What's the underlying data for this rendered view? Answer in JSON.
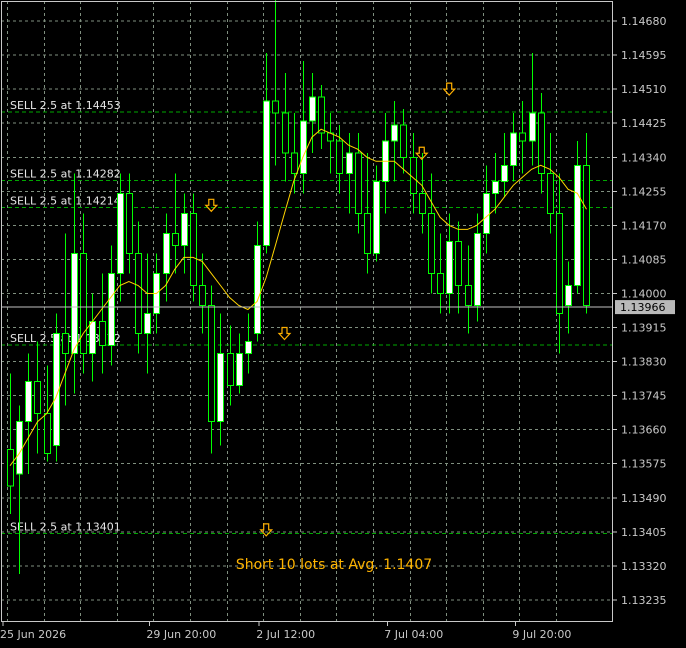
{
  "colors": {
    "background": "#000000",
    "grid": "#7f8f7f",
    "axis": "#c8c8c8",
    "bull": "#ffffff",
    "bear": "#000000",
    "wick": "#00ff00",
    "ma": "#ffd400",
    "trade_line": "#00a800",
    "trade_label": "#e6e6e6",
    "arrow": "#ffb000",
    "price_box_bg": "#b9b9b9",
    "summary": "#ffb400"
  },
  "chart_data": {
    "type": "candlestick",
    "symbol_timeframe": "",
    "price_axis_labels": [
      "1.14680",
      "1.14595",
      "1.14510",
      "1.14425",
      "1.14340",
      "1.14255",
      "1.14170",
      "1.14085",
      "1.14000",
      "1.13915",
      "1.13830",
      "1.13745",
      "1.13660",
      "1.13575",
      "1.13490",
      "1.13405",
      "1.13320",
      "1.13235"
    ],
    "time_axis_labels": [
      "25 Jun 2026",
      "29 Jun 20:00",
      "2 Jul 12:00",
      "7 Jul 04:00",
      "9 Jul 20:00"
    ],
    "ylim": [
      1.1318,
      1.1473
    ],
    "current_price": "1.13966",
    "trade_lines": [
      {
        "label": "SELL 2.5 at 1.14453",
        "price": 1.14453
      },
      {
        "label": "SELL 2.5 at 1.14282",
        "price": 1.14282
      },
      {
        "label": "SELL 2.5 at 1.14214",
        "price": 1.14214
      },
      {
        "label": "SELL 2.5 at 1.13872",
        "price": 1.13872
      },
      {
        "label": "SELL 2.5 at 1.13401",
        "price": 1.13401
      }
    ],
    "sell_arrows": [
      {
        "index": 48,
        "price": 1.1451
      },
      {
        "index": 45,
        "price": 1.1435
      },
      {
        "index": 22,
        "price": 1.1422
      },
      {
        "index": 30,
        "price": 1.139
      },
      {
        "index": 28,
        "price": 1.1341
      }
    ],
    "summary_text": "Short 10 lots at Avg. 1.1407",
    "candles": [
      {
        "o": 1.1361,
        "h": 1.138,
        "l": 1.1345,
        "c": 1.1352
      },
      {
        "o": 1.1355,
        "h": 1.1372,
        "l": 1.133,
        "c": 1.1368
      },
      {
        "o": 1.1368,
        "h": 1.1385,
        "l": 1.1355,
        "c": 1.1378
      },
      {
        "o": 1.1378,
        "h": 1.1388,
        "l": 1.136,
        "c": 1.137
      },
      {
        "o": 1.137,
        "h": 1.1382,
        "l": 1.1358,
        "c": 1.136
      },
      {
        "o": 1.1362,
        "h": 1.1395,
        "l": 1.1358,
        "c": 1.139
      },
      {
        "o": 1.139,
        "h": 1.1415,
        "l": 1.1372,
        "c": 1.1385
      },
      {
        "o": 1.1385,
        "h": 1.143,
        "l": 1.1375,
        "c": 1.141
      },
      {
        "o": 1.141,
        "h": 1.142,
        "l": 1.138,
        "c": 1.1385
      },
      {
        "o": 1.1385,
        "h": 1.14,
        "l": 1.1378,
        "c": 1.1393
      },
      {
        "o": 1.1393,
        "h": 1.1405,
        "l": 1.138,
        "c": 1.1387
      },
      {
        "o": 1.1387,
        "h": 1.1412,
        "l": 1.1382,
        "c": 1.1405
      },
      {
        "o": 1.1405,
        "h": 1.143,
        "l": 1.1398,
        "c": 1.1425
      },
      {
        "o": 1.1425,
        "h": 1.143,
        "l": 1.1405,
        "c": 1.141
      },
      {
        "o": 1.141,
        "h": 1.1418,
        "l": 1.1385,
        "c": 1.139
      },
      {
        "o": 1.139,
        "h": 1.141,
        "l": 1.138,
        "c": 1.1395
      },
      {
        "o": 1.1395,
        "h": 1.141,
        "l": 1.139,
        "c": 1.1405
      },
      {
        "o": 1.1405,
        "h": 1.142,
        "l": 1.1398,
        "c": 1.1415
      },
      {
        "o": 1.1415,
        "h": 1.143,
        "l": 1.1405,
        "c": 1.1412
      },
      {
        "o": 1.1412,
        "h": 1.1425,
        "l": 1.1405,
        "c": 1.142
      },
      {
        "o": 1.142,
        "h": 1.1425,
        "l": 1.1398,
        "c": 1.1402
      },
      {
        "o": 1.1402,
        "h": 1.141,
        "l": 1.139,
        "c": 1.1397
      },
      {
        "o": 1.1397,
        "h": 1.1402,
        "l": 1.136,
        "c": 1.1368
      },
      {
        "o": 1.1368,
        "h": 1.1395,
        "l": 1.1362,
        "c": 1.1385
      },
      {
        "o": 1.1385,
        "h": 1.1392,
        "l": 1.1372,
        "c": 1.1377
      },
      {
        "o": 1.1377,
        "h": 1.139,
        "l": 1.1375,
        "c": 1.1385
      },
      {
        "o": 1.1385,
        "h": 1.1395,
        "l": 1.138,
        "c": 1.1388
      },
      {
        "o": 1.139,
        "h": 1.1418,
        "l": 1.1388,
        "c": 1.1412
      },
      {
        "o": 1.1412,
        "h": 1.146,
        "l": 1.141,
        "c": 1.1448
      },
      {
        "o": 1.1448,
        "h": 1.1475,
        "l": 1.1432,
        "c": 1.1445
      },
      {
        "o": 1.1445,
        "h": 1.1455,
        "l": 1.1428,
        "c": 1.1435
      },
      {
        "o": 1.1435,
        "h": 1.1445,
        "l": 1.1425,
        "c": 1.143
      },
      {
        "o": 1.143,
        "h": 1.1458,
        "l": 1.1425,
        "c": 1.1443
      },
      {
        "o": 1.1443,
        "h": 1.1455,
        "l": 1.1435,
        "c": 1.1449
      },
      {
        "o": 1.1449,
        "h": 1.1452,
        "l": 1.1436,
        "c": 1.144
      },
      {
        "o": 1.144,
        "h": 1.1445,
        "l": 1.143,
        "c": 1.1438
      },
      {
        "o": 1.1438,
        "h": 1.1442,
        "l": 1.1425,
        "c": 1.143
      },
      {
        "o": 1.143,
        "h": 1.144,
        "l": 1.142,
        "c": 1.1435
      },
      {
        "o": 1.1435,
        "h": 1.144,
        "l": 1.1415,
        "c": 1.142
      },
      {
        "o": 1.142,
        "h": 1.1435,
        "l": 1.1405,
        "c": 1.141
      },
      {
        "o": 1.141,
        "h": 1.1432,
        "l": 1.1408,
        "c": 1.1428
      },
      {
        "o": 1.1428,
        "h": 1.1445,
        "l": 1.142,
        "c": 1.1438
      },
      {
        "o": 1.1438,
        "h": 1.1448,
        "l": 1.1428,
        "c": 1.1442
      },
      {
        "o": 1.1442,
        "h": 1.1446,
        "l": 1.143,
        "c": 1.1434
      },
      {
        "o": 1.1434,
        "h": 1.144,
        "l": 1.142,
        "c": 1.1425
      },
      {
        "o": 1.1425,
        "h": 1.1435,
        "l": 1.1415,
        "c": 1.142
      },
      {
        "o": 1.142,
        "h": 1.143,
        "l": 1.14,
        "c": 1.1405
      },
      {
        "o": 1.1405,
        "h": 1.1415,
        "l": 1.1395,
        "c": 1.14
      },
      {
        "o": 1.14,
        "h": 1.142,
        "l": 1.1395,
        "c": 1.1413
      },
      {
        "o": 1.1413,
        "h": 1.1418,
        "l": 1.1395,
        "c": 1.1402
      },
      {
        "o": 1.1402,
        "h": 1.1412,
        "l": 1.139,
        "c": 1.1397
      },
      {
        "o": 1.1397,
        "h": 1.142,
        "l": 1.1393,
        "c": 1.1415
      },
      {
        "o": 1.1415,
        "h": 1.1432,
        "l": 1.141,
        "c": 1.1425
      },
      {
        "o": 1.1425,
        "h": 1.1435,
        "l": 1.142,
        "c": 1.1428
      },
      {
        "o": 1.1428,
        "h": 1.144,
        "l": 1.1424,
        "c": 1.1432
      },
      {
        "o": 1.1432,
        "h": 1.1445,
        "l": 1.1428,
        "c": 1.144
      },
      {
        "o": 1.144,
        "h": 1.1448,
        "l": 1.143,
        "c": 1.1438
      },
      {
        "o": 1.1438,
        "h": 1.146,
        "l": 1.1432,
        "c": 1.1445
      },
      {
        "o": 1.1445,
        "h": 1.145,
        "l": 1.1425,
        "c": 1.143
      },
      {
        "o": 1.143,
        "h": 1.144,
        "l": 1.1415,
        "c": 1.142
      },
      {
        "o": 1.142,
        "h": 1.143,
        "l": 1.1385,
        "c": 1.1395
      },
      {
        "o": 1.1397,
        "h": 1.1408,
        "l": 1.139,
        "c": 1.1402
      },
      {
        "o": 1.1402,
        "h": 1.1438,
        "l": 1.14,
        "c": 1.1432
      },
      {
        "o": 1.1432,
        "h": 1.144,
        "l": 1.1395,
        "c": 1.1397
      }
    ],
    "ma": [
      1.1357,
      1.136,
      1.1364,
      1.1368,
      1.137,
      1.1374,
      1.138,
      1.1386,
      1.139,
      1.1393,
      1.1396,
      1.1399,
      1.1402,
      1.1403,
      1.1402,
      1.14,
      1.14,
      1.1402,
      1.1406,
      1.1409,
      1.1409,
      1.1408,
      1.1405,
      1.1402,
      1.1399,
      1.1397,
      1.1396,
      1.1398,
      1.1404,
      1.1412,
      1.142,
      1.1428,
      1.1434,
      1.1439,
      1.1441,
      1.144,
      1.1439,
      1.1437,
      1.1436,
      1.1434,
      1.1433,
      1.1433,
      1.1433,
      1.1431,
      1.1429,
      1.1427,
      1.1423,
      1.1419,
      1.1417,
      1.1416,
      1.1416,
      1.1417,
      1.1419,
      1.1421,
      1.1424,
      1.1427,
      1.1429,
      1.1431,
      1.1432,
      1.1431,
      1.1429,
      1.1426,
      1.1425,
      1.1421
    ]
  }
}
